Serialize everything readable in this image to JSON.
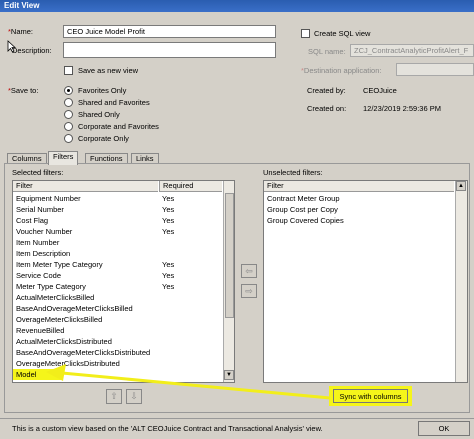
{
  "window": {
    "title": "Edit View"
  },
  "form": {
    "name_label": "Name:",
    "name_value": "CEO Juice Model Profit",
    "description_label": "Description:",
    "description_value": "",
    "save_as_new_label": "Save as new view",
    "save_to_label": "Save to:",
    "save_to_options": [
      "Favorites Only",
      "Shared and Favorites",
      "Shared Only",
      "Corporate and Favorites",
      "Corporate Only"
    ],
    "create_sql_label": "Create SQL view",
    "sql_name_label": "SQL name:",
    "sql_name_value": "ZCJ_ContractAnalyticProfitAlert_F",
    "destination_label": "Destination application:",
    "destination_value": "",
    "created_by_label": "Created by:",
    "created_by_value": "CEOJuice",
    "created_on_label": "Created on:",
    "created_on_value": "12/23/2019 2:59:36 PM"
  },
  "tabs": [
    "Columns",
    "Filters",
    "Functions",
    "Links"
  ],
  "selected_filters": {
    "label": "Selected filters:",
    "headers": [
      "Filter",
      "Required"
    ],
    "rows": [
      [
        "Equipment Number",
        "Yes"
      ],
      [
        "Serial Number",
        "Yes"
      ],
      [
        "Cost Flag",
        "Yes"
      ],
      [
        "Voucher Number",
        "Yes"
      ],
      [
        "Item Number",
        ""
      ],
      [
        "Item Description",
        ""
      ],
      [
        "Item Meter Type Category",
        "Yes"
      ],
      [
        "Service Code",
        "Yes"
      ],
      [
        "Meter Type Category",
        "Yes"
      ],
      [
        "ActualMeterClicksBilled",
        ""
      ],
      [
        "BaseAndOverageMeterClicksBilled",
        ""
      ],
      [
        "OverageMeterClicksBilled",
        ""
      ],
      [
        "RevenueBilled",
        ""
      ],
      [
        "ActualMeterClicksDistributed",
        ""
      ],
      [
        "BaseAndOverageMeterClicksDistributed",
        ""
      ],
      [
        "OverageMeterClicksDistributed",
        ""
      ],
      [
        "Model",
        ""
      ]
    ]
  },
  "unselected_filters": {
    "label": "Unselected filters:",
    "header": "Filter",
    "rows": [
      "Contract Meter Group",
      "Group Cost per Copy",
      "Group Covered Copies"
    ]
  },
  "buttons": {
    "sync": "Sync with columns",
    "ok": "OK"
  },
  "icons": {
    "move_left": "arrow-left-icon",
    "move_right": "arrow-right-icon",
    "move_up": "arrow-up-icon",
    "move_down": "arrow-down-icon"
  },
  "status": {
    "text": "This is a custom view based on the 'ALT CEOJuice Contract and Transactional Analysis' view."
  },
  "colors": {
    "highlight": "#f5f51a",
    "annotation_arrow": "#f2ee1a"
  }
}
